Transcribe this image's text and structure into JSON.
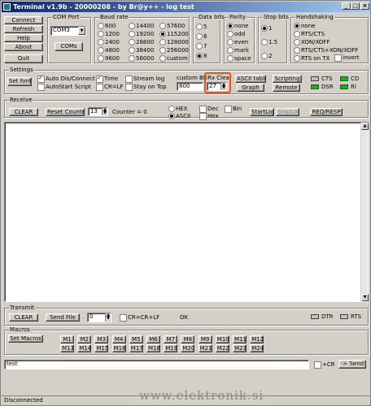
{
  "window": {
    "title": "Terminal v1.9b - 20000208 - by Br@y++ - log test"
  },
  "title_buttons": [
    "_",
    "□",
    "×"
  ],
  "left_buttons": [
    "Connect",
    "Refresh",
    "Help",
    "About",
    "Quit"
  ],
  "com_port": {
    "title": "COM Port",
    "value": "COM3",
    "button": "COMs"
  },
  "baud": {
    "title": "Baud rate",
    "options": [
      "600",
      "14400",
      "57600",
      "1200",
      "19200",
      "115200",
      "2400",
      "28800",
      "128000",
      "4800",
      "38400",
      "256000",
      "9600",
      "56000",
      "custom"
    ],
    "selected": "115200"
  },
  "databits": {
    "title": "Data bits",
    "options": [
      "5",
      "6",
      "7",
      "8"
    ],
    "selected": "8"
  },
  "parity": {
    "title": "Parity",
    "options": [
      "none",
      "odd",
      "even",
      "mark",
      "space"
    ],
    "selected": "none"
  },
  "stopbits": {
    "title": "Stop bits",
    "options": [
      "1",
      "1.5",
      "2"
    ],
    "selected": "1"
  },
  "handshaking": {
    "title": "Handshaking",
    "options": [
      "none",
      "RTS/CTS",
      "XON/XOFF",
      "RTS/CTS+XON/XOFF",
      "RTS on TX"
    ],
    "selected": "none",
    "invert_label": "invert"
  },
  "settings": {
    "title": "Settings",
    "set_font": "Set font",
    "checks": [
      {
        "label": "Auto Dis/Connect",
        "on": true
      },
      {
        "label": "Time",
        "on": true
      },
      {
        "label": "Stream log",
        "on": false
      },
      {
        "label": "AutoStart Script",
        "on": false
      },
      {
        "label": "CR=LF",
        "on": false
      },
      {
        "label": "Stay on Top",
        "on": false
      }
    ],
    "custom_br_label": "custom BR",
    "custom_br_value": "800",
    "rx_clear_label": "Rx Clear",
    "rx_clear_value": "27",
    "ascii_table": "ASCII table",
    "graph": "Graph",
    "scripting": "Scripting",
    "remote": "Remote",
    "leds": [
      {
        "label": "CTS",
        "color": "#c0c0c0"
      },
      {
        "label": "CD",
        "color": "#00c000"
      },
      {
        "label": "DSR",
        "color": "#00c000"
      },
      {
        "label": "RI",
        "color": "#00c000"
      }
    ]
  },
  "receive": {
    "title": "Receive",
    "clear": "CLEAR",
    "reset_counter": "Reset Counter",
    "counter_value": "13",
    "counter_label": "Counter = 0",
    "radios": [
      "HEX",
      "ASCII"
    ],
    "selected": "ASCII",
    "checks": [
      "Dec",
      "Bin",
      "Hex"
    ],
    "start_log": "StartLog",
    "stop_log": "StopLog",
    "req_resp": "REQ/RESP"
  },
  "transmit": {
    "title": "Transmit",
    "clear": "CLEAR",
    "send_file": "Send File",
    "value": "0",
    "crlf_label": "CR=CR+LF",
    "status": "OK",
    "leds": [
      {
        "label": "DTR",
        "color": "#c0c0c0"
      },
      {
        "label": "RTS",
        "color": "#c0c0c0"
      }
    ]
  },
  "macros": {
    "title": "Macros",
    "set_button": "Set Macros",
    "row1": [
      "M1",
      "M2",
      "M3",
      "M4",
      "M5",
      "M6",
      "M7",
      "M8",
      "M9",
      "M10",
      "M11",
      "M12"
    ],
    "row2": [
      "M13",
      "M14",
      "M15",
      "M16",
      "M17",
      "M18",
      "M19",
      "M20",
      "M21",
      "M22",
      "M23",
      "M24"
    ]
  },
  "send": {
    "input": "test",
    "plus_cr": "+CR",
    "send_button": "-> Send"
  },
  "status_bar": {
    "text": "Disconnected"
  },
  "watermark": "www.elektronik.si",
  "accent_color": "#e8541c"
}
